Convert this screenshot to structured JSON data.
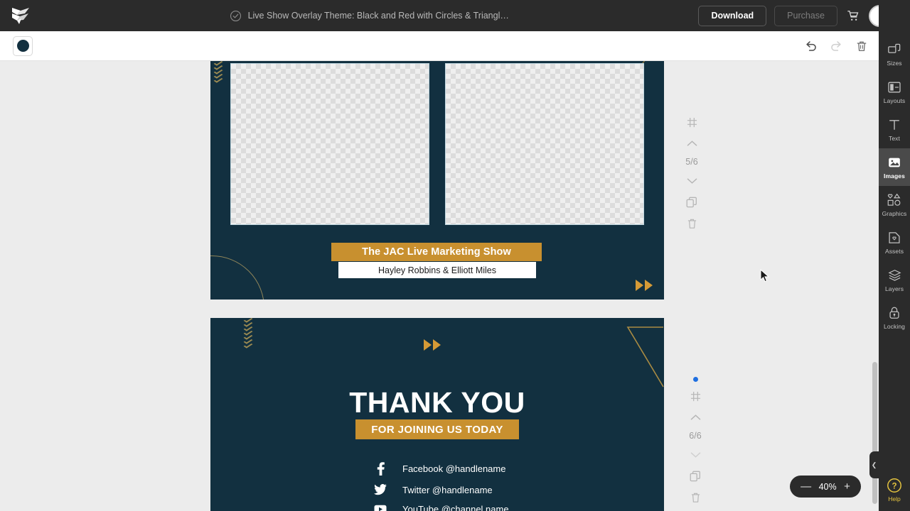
{
  "topbar": {
    "logo_icon": "placeit-leaf-logo",
    "saved_icon": "check-circle-icon",
    "doc_title": "Live Show Overlay Theme: Black and Red with Circles & Triangl…",
    "download_label": "Download",
    "purchase_label": "Purchase",
    "cart_icon": "shopping-cart-icon",
    "avatar_icon": "user-avatar",
    "caret_icon": "chevron-down-icon"
  },
  "toolbar": {
    "color_swatch": "#133040",
    "swatch_icon": "color-circle-icon",
    "undo_icon": "undo-arrow-icon",
    "redo_icon": "redo-arrow-icon",
    "delete_icon": "trash-icon"
  },
  "sidebar": {
    "items": [
      {
        "label": "Sizes",
        "icon": "sizes-icon",
        "active": false
      },
      {
        "label": "Layouts",
        "icon": "layouts-icon",
        "active": false
      },
      {
        "label": "Text",
        "icon": "text-t-icon",
        "active": false
      },
      {
        "label": "Images",
        "icon": "image-icon",
        "active": true
      },
      {
        "label": "Graphics",
        "icon": "graphics-shapes-icon",
        "active": false
      },
      {
        "label": "Assets",
        "icon": "assets-folder-icon",
        "active": false
      },
      {
        "label": "Layers",
        "icon": "layers-stack-icon",
        "active": false
      },
      {
        "label": "Locking",
        "icon": "padlock-icon",
        "active": false
      }
    ],
    "help_label": "Help",
    "help_icon": "question-mark-circle-icon",
    "collapse_icon": "chevron-left-icon"
  },
  "zoom_control": {
    "minus_label": "—",
    "value": "40%",
    "plus_label": "+"
  },
  "page_rails": [
    {
      "grid_icon": "grid-icon",
      "up_icon": "chevron-up-icon",
      "page_label": "5/6",
      "down_icon": "chevron-down-icon",
      "duplicate_icon": "duplicate-icon",
      "delete_icon": "trash-icon",
      "active_dot": false
    },
    {
      "grid_icon": "grid-icon",
      "up_icon": "chevron-up-icon",
      "page_label": "6/6",
      "down_icon": "chevron-down-icon",
      "duplicate_icon": "duplicate-icon",
      "delete_icon": "trash-icon",
      "active_dot": true
    }
  ],
  "colors": {
    "slide_background": "#123040",
    "gold_accent": "#c8902f",
    "gold_line": "#a98b43",
    "chevron_gold": "#9b8a52",
    "arrow_gold": "#d59a36",
    "help_yellow": "#e4c33f",
    "active_dot_blue": "#1f6fe0",
    "canvas_background": "#ececec",
    "chrome_dark": "#2b2b2b"
  },
  "slides": [
    {
      "id": "slide-5",
      "photo_placeholders": [
        {
          "name": "photo-placeholder-left"
        },
        {
          "name": "photo-placeholder-right"
        }
      ],
      "title": "The JAC Live Marketing Show",
      "subtitle": "Hayley Robbins & Elliott Miles",
      "decorations": [
        "gold-chevrons-left",
        "gold-diagonal-line",
        "gold-quarter-arc",
        "gold-double-arrow"
      ]
    },
    {
      "id": "slide-6",
      "heading": "THANK YOU",
      "tagline": "FOR JOINING US TODAY",
      "socials": [
        {
          "icon": "facebook-icon",
          "text": "Facebook @handlename"
        },
        {
          "icon": "twitter-icon",
          "text": "Twitter @handlename"
        },
        {
          "icon": "youtube-icon",
          "text": "YouTube @channel name"
        }
      ],
      "decorations": [
        "gold-chevrons-left",
        "gold-double-arrow",
        "gold-open-triangle"
      ]
    }
  ]
}
